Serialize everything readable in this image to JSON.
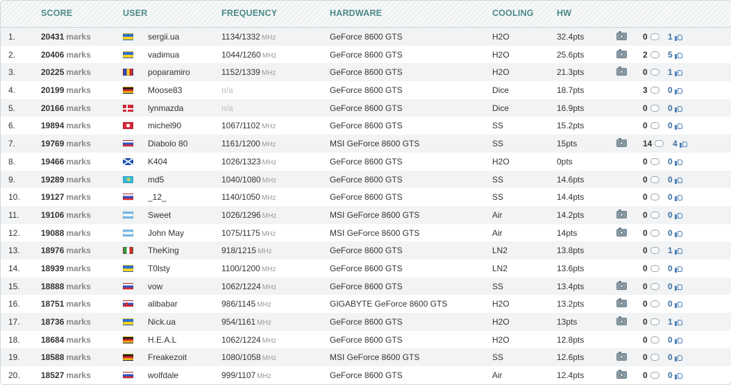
{
  "header": {
    "score": "SCORE",
    "user": "USER",
    "frequency": "FREQUENCY",
    "hardware": "HARDWARE",
    "cooling": "COOLING",
    "hw": "HW"
  },
  "units": {
    "marks": "marks",
    "mhz": "MHz"
  },
  "colors": {
    "header_text": "#4c8a88",
    "likes": "#3d6e9e",
    "row_alt": "#f1f3f4"
  },
  "rows": [
    {
      "rank": "1.",
      "score": "20431",
      "user": "sergii.ua",
      "flag": "ukraine-flag",
      "freq": "1134/1332",
      "hardware": "GeForce 8600 GTS",
      "cooling": "H2O",
      "pts": "32.4pts",
      "photo": true,
      "comments": "0",
      "likes": "1"
    },
    {
      "rank": "2.",
      "score": "20406",
      "user": "vadimua",
      "flag": "ukraine-flag",
      "freq": "1044/1260",
      "hardware": "GeForce 8600 GTS",
      "cooling": "H2O",
      "pts": "25.6pts",
      "photo": true,
      "comments": "2",
      "likes": "5"
    },
    {
      "rank": "3.",
      "score": "20225",
      "user": "poparamiro",
      "flag": "romania-flag",
      "freq": "1152/1339",
      "hardware": "GeForce 8600 GTS",
      "cooling": "H2O",
      "pts": "21.3pts",
      "photo": true,
      "comments": "0",
      "likes": "1"
    },
    {
      "rank": "4.",
      "score": "20199",
      "user": "Moose83",
      "flag": "germany-flag",
      "freq": "n/a",
      "hardware": "GeForce 8600 GTS",
      "cooling": "Dice",
      "pts": "18.7pts",
      "photo": false,
      "comments": "3",
      "likes": "0"
    },
    {
      "rank": "5.",
      "score": "20166",
      "user": "lynmazda",
      "flag": "denmark-flag",
      "freq": "n/a",
      "hardware": "GeForce 8600 GTS",
      "cooling": "Dice",
      "pts": "16.9pts",
      "photo": false,
      "comments": "0",
      "likes": "0"
    },
    {
      "rank": "6.",
      "score": "19894",
      "user": "michel90",
      "flag": "switzerland-flag",
      "freq": "1067/1102",
      "hardware": "GeForce 8600 GTS",
      "cooling": "SS",
      "pts": "15.2pts",
      "photo": false,
      "comments": "0",
      "likes": "0"
    },
    {
      "rank": "7.",
      "score": "19769",
      "user": "Diabolo 80",
      "flag": "russia-flag",
      "freq": "1161/1200",
      "hardware": "MSI GeForce 8600 GTS",
      "cooling": "SS",
      "pts": "15pts",
      "photo": true,
      "comments": "14",
      "likes": "4"
    },
    {
      "rank": "8.",
      "score": "19466",
      "user": "K404",
      "flag": "scotland-flag",
      "freq": "1026/1323",
      "hardware": "GeForce 8600 GTS",
      "cooling": "H2O",
      "pts": "0pts",
      "photo": false,
      "comments": "0",
      "likes": "0"
    },
    {
      "rank": "9.",
      "score": "19289",
      "user": "md5",
      "flag": "kazakhstan-flag",
      "freq": "1040/1080",
      "hardware": "GeForce 8600 GTS",
      "cooling": "SS",
      "pts": "14.6pts",
      "photo": false,
      "comments": "0",
      "likes": "0"
    },
    {
      "rank": "10.",
      "score": "19127",
      "user": "_12_",
      "flag": "russia-flag",
      "freq": "1140/1050",
      "hardware": "GeForce 8600 GTS",
      "cooling": "SS",
      "pts": "14.4pts",
      "photo": false,
      "comments": "0",
      "likes": "0"
    },
    {
      "rank": "11.",
      "score": "19106",
      "user": "Sweet",
      "flag": "argentina-flag",
      "freq": "1026/1296",
      "hardware": "MSI GeForce 8600 GTS",
      "cooling": "Air",
      "pts": "14.2pts",
      "photo": true,
      "comments": "0",
      "likes": "0"
    },
    {
      "rank": "12.",
      "score": "19088",
      "user": "John May",
      "flag": "argentina-flag",
      "freq": "1075/1175",
      "hardware": "MSI GeForce 8600 GTS",
      "cooling": "Air",
      "pts": "14pts",
      "photo": true,
      "comments": "0",
      "likes": "0"
    },
    {
      "rank": "13.",
      "score": "18976",
      "user": "TheKing",
      "flag": "italy-flag",
      "freq": "918/1215",
      "hardware": "GeForce 8600 GTS",
      "cooling": "LN2",
      "pts": "13.8pts",
      "photo": false,
      "comments": "0",
      "likes": "1"
    },
    {
      "rank": "14.",
      "score": "18939",
      "user": "T0lsty",
      "flag": "ukraine-flag",
      "freq": "1100/1200",
      "hardware": "GeForce 8600 GTS",
      "cooling": "LN2",
      "pts": "13.6pts",
      "photo": false,
      "comments": "0",
      "likes": "0"
    },
    {
      "rank": "15.",
      "score": "18888",
      "user": "vow",
      "flag": "russia-flag",
      "freq": "1062/1224",
      "hardware": "GeForce 8600 GTS",
      "cooling": "SS",
      "pts": "13.4pts",
      "photo": true,
      "comments": "0",
      "likes": "0"
    },
    {
      "rank": "16.",
      "score": "18751",
      "user": "alibabar",
      "flag": "slovakia-flag",
      "freq": "986/1145",
      "hardware": "GIGABYTE GeForce 8600 GTS",
      "cooling": "H2O",
      "pts": "13.2pts",
      "photo": true,
      "comments": "0",
      "likes": "0"
    },
    {
      "rank": "17.",
      "score": "18736",
      "user": "Nick.ua",
      "flag": "ukraine-flag",
      "freq": "954/1161",
      "hardware": "GeForce 8600 GTS",
      "cooling": "H2O",
      "pts": "13pts",
      "photo": true,
      "comments": "0",
      "likes": "1"
    },
    {
      "rank": "18.",
      "score": "18684",
      "user": "H.E.A.L",
      "flag": "germany-flag",
      "freq": "1062/1224",
      "hardware": "GeForce 8600 GTS",
      "cooling": "H2O",
      "pts": "12.8pts",
      "photo": false,
      "comments": "0",
      "likes": "0"
    },
    {
      "rank": "19.",
      "score": "18588",
      "user": "Freakezoit",
      "flag": "germany-flag",
      "freq": "1080/1058",
      "hardware": "MSI GeForce 8600 GTS",
      "cooling": "SS",
      "pts": "12.6pts",
      "photo": true,
      "comments": "0",
      "likes": "0"
    },
    {
      "rank": "20.",
      "score": "18527",
      "user": "wolfdale",
      "flag": "russia-flag",
      "freq": "999/1107",
      "hardware": "GeForce 8600 GTS",
      "cooling": "Air",
      "pts": "12.4pts",
      "photo": true,
      "comments": "0",
      "likes": "0"
    }
  ]
}
